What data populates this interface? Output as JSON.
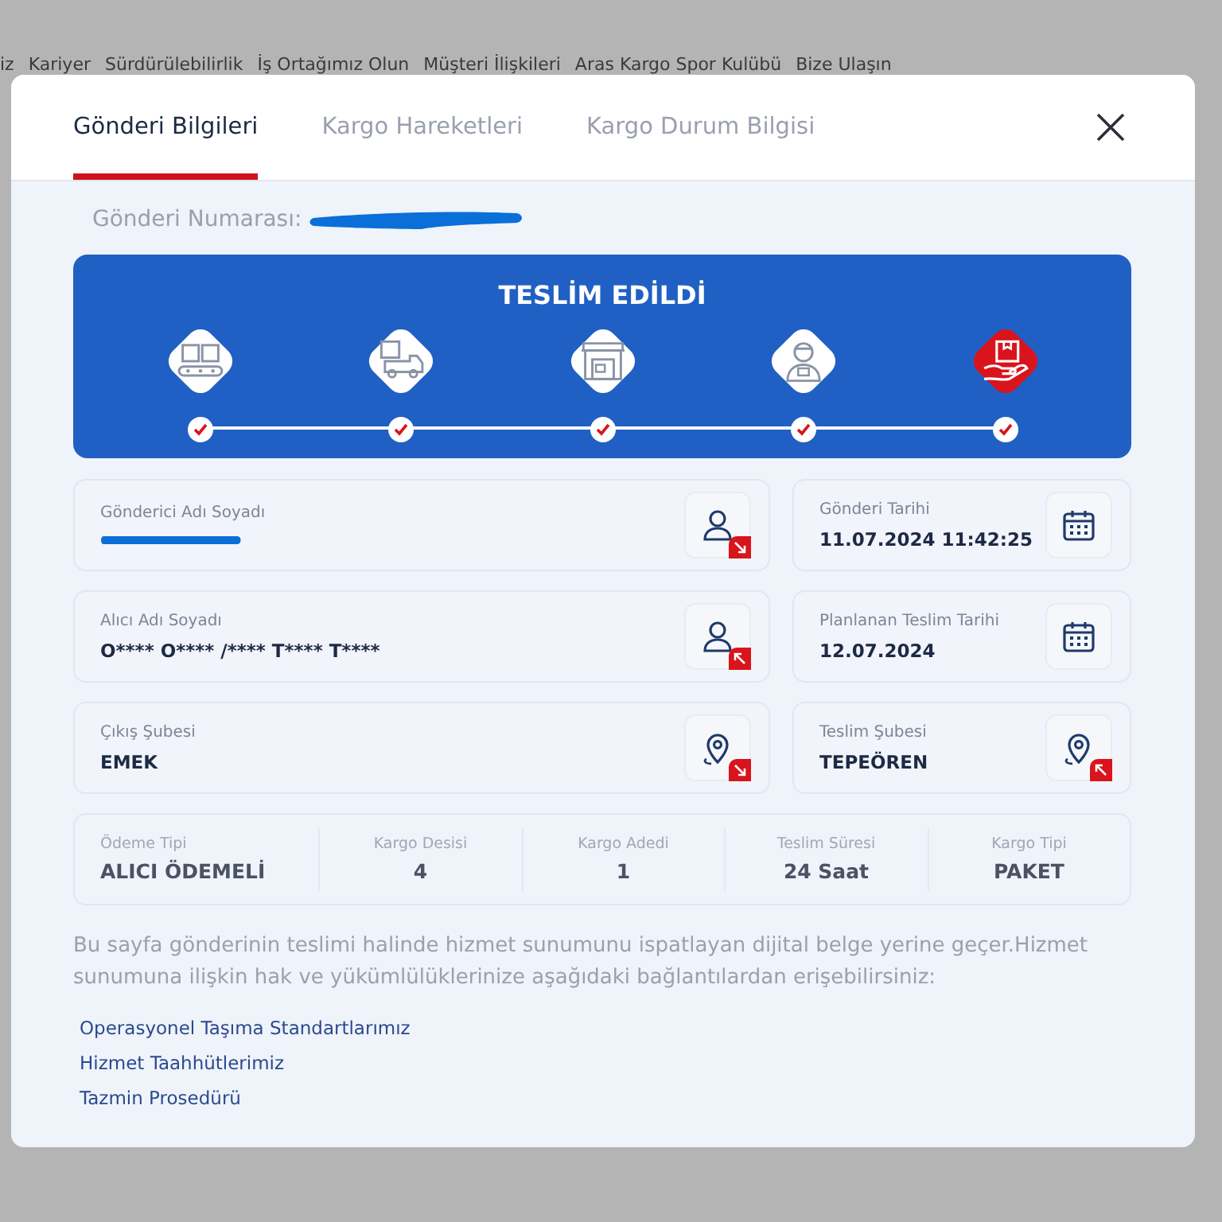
{
  "background_nav": [
    "iz",
    "Kariyer",
    "Sürdürülebilirlik",
    "İş Ortağımız Olun",
    "Müşteri İlişkileri",
    "Aras Kargo Spor Kulübü",
    "Bize Ulaşın"
  ],
  "tabs": [
    {
      "label": "Gönderi Bilgileri",
      "selected": true
    },
    {
      "label": "Kargo Hareketleri",
      "selected": false
    },
    {
      "label": "Kargo Durum Bilgisi",
      "selected": false
    }
  ],
  "shipment_number": {
    "label": "Gönderi Numarası:"
  },
  "status": {
    "title": "TESLİM EDİLDİ",
    "steps": [
      {
        "done": true,
        "selected": false
      },
      {
        "done": true,
        "selected": false
      },
      {
        "done": true,
        "selected": false
      },
      {
        "done": true,
        "selected": false
      },
      {
        "done": true,
        "selected": true
      }
    ]
  },
  "details": [
    {
      "label": "Gönderici Adı Soyadı"
    },
    {
      "label": "Gönderi Tarihi",
      "value": "11.07.2024 11:42:25"
    },
    {
      "label": "Alıcı Adı Soyadı",
      "value": "O**** O**** /**** T**** T****"
    },
    {
      "label": "Planlanan Teslim Tarihi",
      "value": "12.07.2024"
    },
    {
      "label": "Çıkış Şubesi",
      "value": "EMEK"
    },
    {
      "label": "Teslim Şubesi",
      "value": "TEPEÖREN"
    }
  ],
  "summary": [
    {
      "label": "Ödeme Tipi",
      "value": "ALICI ÖDEMELİ"
    },
    {
      "label": "Kargo Desisi",
      "value": "4"
    },
    {
      "label": "Kargo Adedi",
      "value": "1"
    },
    {
      "label": "Teslim Süresi",
      "value": "24 Saat"
    },
    {
      "label": "Kargo Tipi",
      "value": "PAKET"
    }
  ],
  "notice": "Bu sayfa gönderinin teslimi halinde hizmet sunumunu ispatlayan dijital belge yerine geçer.Hizmet sunumuna ilişkin hak ve yükümlülüklerinize aşağıdaki bağlantılardan erişebilirsiniz:",
  "links": [
    "Operasyonel Taşıma Standartlarımız",
    "Hizmet Taahhütlerimiz",
    "Tazmin Prosedürü"
  ]
}
